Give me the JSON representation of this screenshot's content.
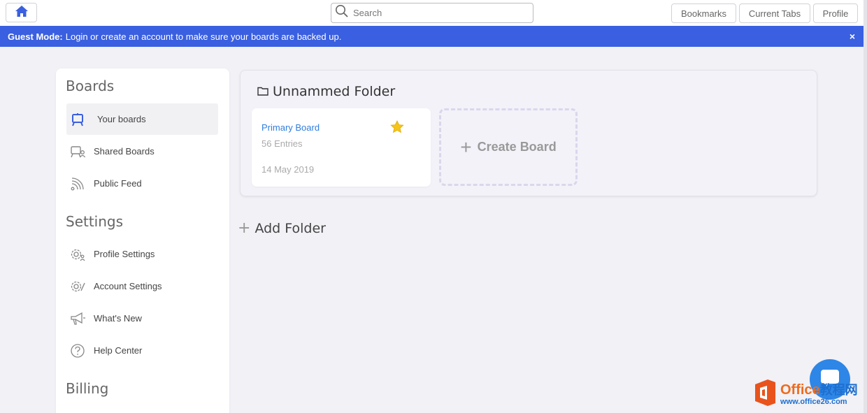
{
  "topbar": {
    "home_icon": "home-icon",
    "search": {
      "placeholder": "Search",
      "value": ""
    },
    "buttons": {
      "bookmarks": "Bookmarks",
      "current_tabs": "Current Tabs",
      "profile": "Profile"
    }
  },
  "banner": {
    "label": "Guest Mode:",
    "message": "Login or create an account to make sure your boards are backed up.",
    "close": "×",
    "color": "#3a5fe0"
  },
  "sidebar": {
    "boards_title": "Boards",
    "boards_items": [
      {
        "label": "Your boards",
        "icon": "board-icon",
        "active": true
      },
      {
        "label": "Shared Boards",
        "icon": "shared-board-icon",
        "active": false
      },
      {
        "label": "Public Feed",
        "icon": "rss-icon",
        "active": false
      }
    ],
    "settings_title": "Settings",
    "settings_items": [
      {
        "label": "Profile Settings",
        "icon": "profile-gear-icon"
      },
      {
        "label": "Account Settings",
        "icon": "account-gear-icon"
      },
      {
        "label": "What's New",
        "icon": "megaphone-icon"
      },
      {
        "label": "Help Center",
        "icon": "help-icon"
      }
    ],
    "billing_title": "Billing"
  },
  "folder": {
    "title": "Unnammed Folder",
    "board": {
      "name": "Primary Board",
      "entries": "56 Entries",
      "date": "14 May 2019",
      "starred": true
    },
    "create_board": "Create Board"
  },
  "add_folder": "Add Folder",
  "watermark": {
    "brand": "Office",
    "brand_cn": "教程网",
    "url": "www.office26.com"
  },
  "colors": {
    "accent": "#3a5fe0",
    "link": "#2f7de0",
    "star": "#f5c518",
    "chat": "#2e86e6"
  }
}
